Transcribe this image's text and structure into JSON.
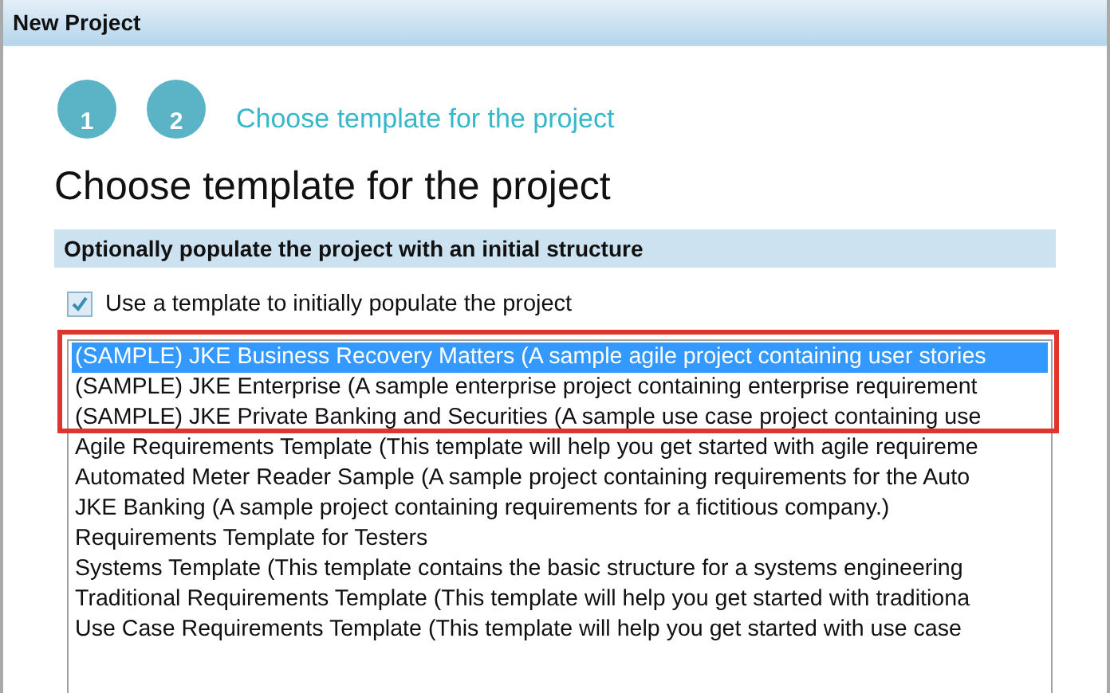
{
  "window": {
    "title": "New Project"
  },
  "steps": [
    {
      "number": "1"
    },
    {
      "number": "2",
      "label": "Choose template for the project"
    }
  ],
  "heading": "Choose template for the project",
  "section": {
    "title": "Optionally populate the project with an initial structure"
  },
  "use_template": {
    "label": "Use a template to initially populate the project",
    "checked": true
  },
  "templates": [
    {
      "text": "(SAMPLE) JKE Business Recovery Matters (A sample agile project containing user stories",
      "selected": true
    },
    {
      "text": "(SAMPLE) JKE Enterprise (A sample enterprise project containing enterprise requirement",
      "selected": false
    },
    {
      "text": "(SAMPLE) JKE Private Banking and Securities (A sample use case project containing use",
      "selected": false
    },
    {
      "text": "Agile Requirements Template (This template will help you get started with agile requireme",
      "selected": false
    },
    {
      "text": "Automated Meter Reader Sample (A sample project containing requirements for the Auto",
      "selected": false
    },
    {
      "text": "JKE Banking (A sample project containing requirements for a fictitious company.)",
      "selected": false
    },
    {
      "text": "Requirements Template for Testers",
      "selected": false
    },
    {
      "text": "Systems Template (This template contains the basic structure for a systems engineering",
      "selected": false
    },
    {
      "text": "Traditional Requirements Template (This template will help you get started with traditiona",
      "selected": false
    },
    {
      "text": "Use Case Requirements Template (This template will help you get started with use case",
      "selected": false
    }
  ]
}
